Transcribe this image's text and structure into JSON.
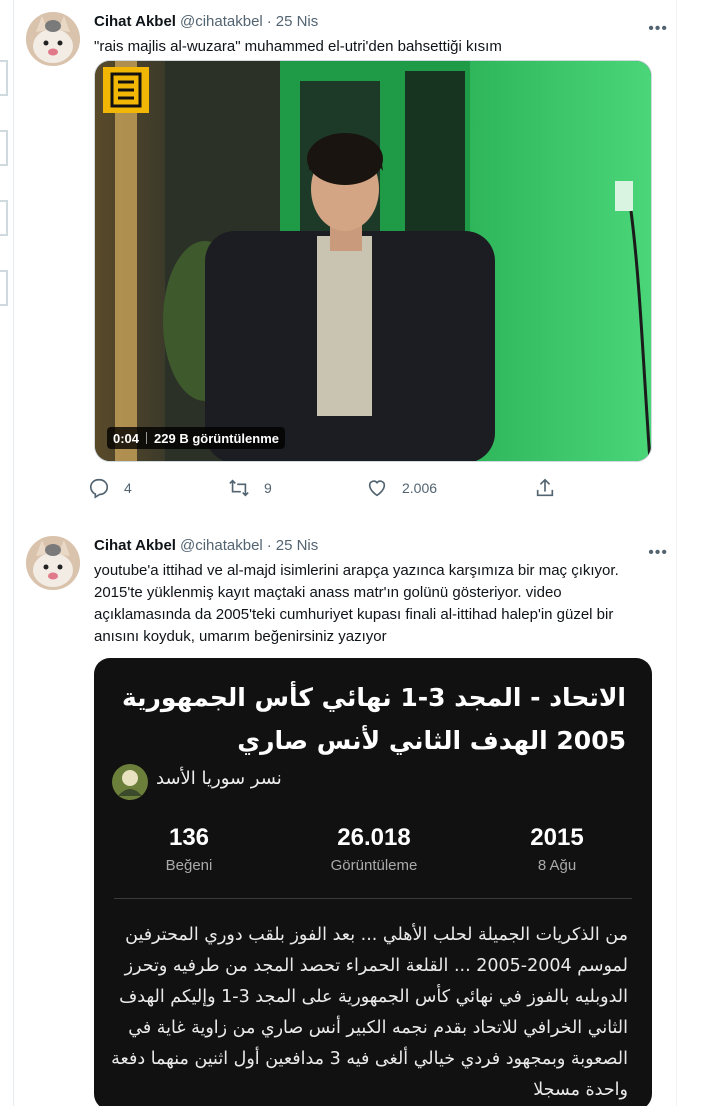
{
  "tweets": [
    {
      "author_name": "Cihat Akbel",
      "handle": "@cihatakbel",
      "separator": "·",
      "date": "25 Nis",
      "text": "\"rais majlis al-wuzara\" muhammed el-utri'den bahsettiği kısım",
      "video": {
        "duration": "0:04",
        "views": "229 B görüntülenme"
      },
      "actions": {
        "reply_count": "4",
        "retweet_count": "9",
        "like_count": "2.006"
      }
    },
    {
      "author_name": "Cihat Akbel",
      "handle": "@cihatakbel",
      "separator": "·",
      "date": "25 Nis",
      "text": "youtube'a ittihad ve al-majd isimlerini arapça yazınca karşımıza bir maç çıkıyor. 2015'te yüklenmiş kayıt maçtaki anass matr'ın golünü gösteriyor. video açıklamasında da 2005'teki cumhuriyet kupası finali al-ittihad halep'in güzel bir anısını koyduk, umarım beğenirsiniz yazıyor",
      "yt_card": {
        "title": "الاتحاد - المجد 3-1 نهائي كأس الجمهورية 2005 الهدف الثاني لأنس صاري",
        "channel": "نسر سوريا الأسد",
        "stats": [
          {
            "value": "136",
            "label": "Beğeni"
          },
          {
            "value": "26.018",
            "label": "Görüntüleme"
          },
          {
            "value": "2015",
            "label": "8 Ağu"
          }
        ],
        "description": "من الذكريات الجميلة لحلب الأهلي ... بعد الفوز بلقب دوري المحترفين لموسم 2004-2005 ... القلعة الحمراء تحصد المجد من طرفيه وتحرز الدوبليه بالفوز في نهائي كأس الجمهورية على المجد 3-1 وإليكم الهدف الثاني الخرافي للاتحاد بقدم نجمه الكبير أنس صاري من زاوية غاية في الصعوبة وبمجهود فردي خيالي ألغى فيه 3 مدافعين أول اثنين منهما دفعة واحدة مسجلا"
      }
    }
  ],
  "icons": {
    "more": "more-horizontal-icon",
    "reply": "reply-icon",
    "retweet": "retweet-icon",
    "like": "heart-icon",
    "share": "share-icon",
    "logo": "channel-logo-icon"
  },
  "colors": {
    "text_primary": "#0f1419",
    "text_secondary": "#536471",
    "border": "#cfd9de",
    "video_green": "#3ecf6a",
    "card_bg": "#111111",
    "logo_yellow": "#f2b705"
  }
}
